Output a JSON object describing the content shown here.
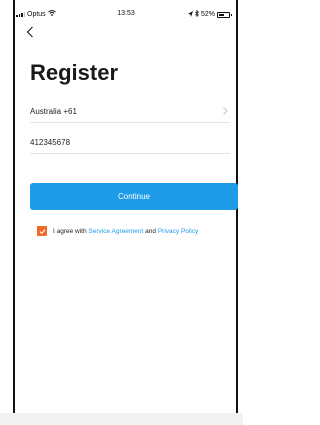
{
  "status_bar": {
    "carrier": "Optus",
    "time": "13:53",
    "battery": "52%",
    "battery_level": 0.52
  },
  "icons": {
    "back": "chevron-left-icon",
    "country_chevron": "chevron-right-icon",
    "checkbox": "checkmark-icon"
  },
  "page": {
    "title": "Register"
  },
  "form": {
    "country": "Australia +61",
    "phone_value": "412345678",
    "continue_label": "Continue"
  },
  "agreement": {
    "prefix": "I agree with",
    "service_link": "Service Agreement",
    "conjunction": "and",
    "privacy_link": "Privacy Policy",
    "checked": true
  },
  "colors": {
    "accent": "#1e9ce8",
    "checkbox": "#ef6a24"
  }
}
